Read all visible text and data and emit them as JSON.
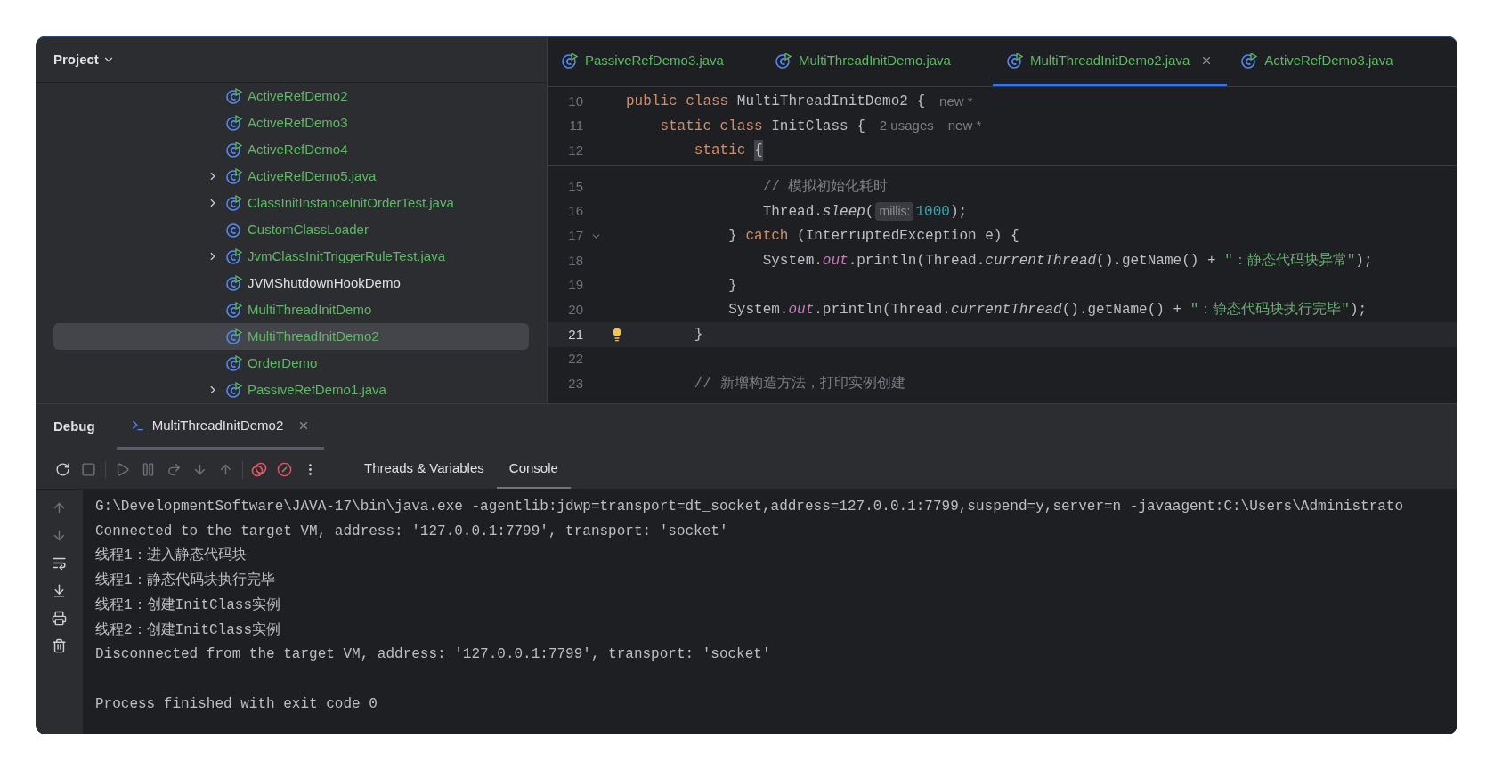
{
  "project": {
    "title": "Project",
    "items": [
      {
        "label": "ActiveRefDemo2",
        "expandable": false,
        "kind": "runnable",
        "color": "#5fb865",
        "selected": false
      },
      {
        "label": "ActiveRefDemo3",
        "expandable": false,
        "kind": "runnable",
        "color": "#5fb865",
        "selected": false
      },
      {
        "label": "ActiveRefDemo4",
        "expandable": false,
        "kind": "runnable",
        "color": "#5fb865",
        "selected": false
      },
      {
        "label": "ActiveRefDemo5.java",
        "expandable": true,
        "kind": "runnable",
        "color": "#5fb865",
        "selected": false
      },
      {
        "label": "ClassInitInstanceInitOrderTest.java",
        "expandable": true,
        "kind": "runnable",
        "color": "#5fb865",
        "selected": false
      },
      {
        "label": "CustomClassLoader",
        "expandable": false,
        "kind": "class",
        "color": "#5fb865",
        "selected": false
      },
      {
        "label": "JvmClassInitTriggerRuleTest.java",
        "expandable": true,
        "kind": "runnable",
        "color": "#5fb865",
        "selected": false
      },
      {
        "label": "JVMShutdownHookDemo",
        "expandable": false,
        "kind": "runnable",
        "color": "#dfe1e5",
        "selected": false
      },
      {
        "label": "MultiThreadInitDemo",
        "expandable": false,
        "kind": "runnable",
        "color": "#5fb865",
        "selected": false
      },
      {
        "label": "MultiThreadInitDemo2",
        "expandable": false,
        "kind": "runnable",
        "color": "#5fb865",
        "selected": true
      },
      {
        "label": "OrderDemo",
        "expandable": false,
        "kind": "runnable",
        "color": "#5fb865",
        "selected": false
      },
      {
        "label": "PassiveRefDemo1.java",
        "expandable": true,
        "kind": "runnable",
        "color": "#5fb865",
        "selected": false
      }
    ]
  },
  "editor": {
    "tabs": [
      {
        "label": "PassiveRefDemo3.java",
        "selected": false
      },
      {
        "label": "MultiThreadInitDemo.java",
        "selected": false
      },
      {
        "label": "MultiThreadInitDemo2.java",
        "selected": true
      },
      {
        "label": "ActiveRefDemo3.java",
        "selected": false
      }
    ],
    "sticky_lines": [
      {
        "number": "10",
        "segments": [
          {
            "kind": "kw",
            "text": "public class "
          },
          {
            "kind": "id",
            "text": "MultiThreadInitDemo2 {"
          },
          {
            "kind": "hint",
            "text": "new *"
          }
        ]
      },
      {
        "number": "11",
        "segments": [
          {
            "kind": "kw",
            "text": "    static class "
          },
          {
            "kind": "id",
            "text": "InitClass {"
          },
          {
            "kind": "hint",
            "text": "2 usages"
          },
          {
            "kind": "hint",
            "text": "new *"
          }
        ]
      },
      {
        "number": "12",
        "segments": [
          {
            "kind": "kw",
            "text": "        static "
          },
          {
            "kind": "brace",
            "text": "{"
          }
        ]
      }
    ],
    "lines": [
      {
        "number": "15",
        "current": false,
        "fold": false,
        "bulb": false,
        "segments": [
          {
            "kind": "cm",
            "text": "                // 模拟初始化耗时"
          }
        ]
      },
      {
        "number": "16",
        "current": false,
        "fold": false,
        "bulb": false,
        "segments": [
          {
            "kind": "id",
            "text": "                Thread."
          },
          {
            "kind": "smethod",
            "text": "sleep"
          },
          {
            "kind": "id",
            "text": "("
          },
          {
            "kind": "param",
            "text": "millis:"
          },
          {
            "kind": "num",
            "text": "1000"
          },
          {
            "kind": "id",
            "text": ");"
          }
        ]
      },
      {
        "number": "17",
        "current": false,
        "fold": true,
        "bulb": false,
        "segments": [
          {
            "kind": "id",
            "text": "            } "
          },
          {
            "kind": "kw",
            "text": "catch "
          },
          {
            "kind": "id",
            "text": "(InterruptedException e) {"
          }
        ]
      },
      {
        "number": "18",
        "current": false,
        "fold": false,
        "bulb": false,
        "segments": [
          {
            "kind": "id",
            "text": "                System."
          },
          {
            "kind": "field",
            "text": "out"
          },
          {
            "kind": "id",
            "text": ".println(Thread."
          },
          {
            "kind": "smethod",
            "text": "currentThread"
          },
          {
            "kind": "id",
            "text": "().getName() + "
          },
          {
            "kind": "str",
            "text": "\"：静态代码块异常\""
          },
          {
            "kind": "id",
            "text": ");"
          }
        ]
      },
      {
        "number": "19",
        "current": false,
        "fold": false,
        "bulb": false,
        "segments": [
          {
            "kind": "id",
            "text": "            }"
          }
        ]
      },
      {
        "number": "20",
        "current": false,
        "fold": false,
        "bulb": false,
        "segments": [
          {
            "kind": "id",
            "text": "            System."
          },
          {
            "kind": "field",
            "text": "out"
          },
          {
            "kind": "id",
            "text": ".println(Thread."
          },
          {
            "kind": "smethod",
            "text": "currentThread"
          },
          {
            "kind": "id",
            "text": "().getName() + "
          },
          {
            "kind": "str",
            "text": "\"：静态代码块执行完毕\""
          },
          {
            "kind": "id",
            "text": ");"
          }
        ]
      },
      {
        "number": "21",
        "current": true,
        "fold": false,
        "bulb": true,
        "segments": [
          {
            "kind": "id",
            "text": "        }"
          }
        ]
      },
      {
        "number": "22",
        "current": false,
        "fold": false,
        "bulb": false
      },
      {
        "number": "23",
        "current": false,
        "fold": false,
        "bulb": false,
        "segments": [
          {
            "kind": "cm",
            "text": "        // 新增构造方法，打印实例创建"
          }
        ]
      }
    ]
  },
  "debug": {
    "title": "Debug",
    "session": "MultiThreadInitDemo2",
    "toolbar": [
      {
        "kind": "rerun",
        "disabled": false
      },
      {
        "kind": "stop",
        "disabled": true
      },
      {
        "kind": "sep"
      },
      {
        "kind": "resume",
        "disabled": true
      },
      {
        "kind": "pause",
        "disabled": true
      },
      {
        "kind": "step_over",
        "disabled": true
      },
      {
        "kind": "step_into",
        "disabled": true
      },
      {
        "kind": "step_out",
        "disabled": true
      },
      {
        "kind": "sep"
      },
      {
        "kind": "breakpoints",
        "disabled": false
      },
      {
        "kind": "mute",
        "disabled": false
      },
      {
        "kind": "more",
        "disabled": false
      }
    ],
    "tabs": [
      {
        "label": "Threads & Variables",
        "selected": false
      },
      {
        "label": "Console",
        "selected": true
      }
    ],
    "console": [
      {
        "kind": "output",
        "text": "G:\\DevelopmentSoftware\\JAVA-17\\bin\\java.exe -agentlib:jdwp=transport=dt_socket,address=127.0.0.1:7799,suspend=y,server=n -javaagent:C:\\Users\\Administrato"
      },
      {
        "kind": "output",
        "text": "Connected to the target VM, address: '127.0.0.1:7799', transport: 'socket'"
      },
      {
        "kind": "output",
        "text": "线程1：进入静态代码块"
      },
      {
        "kind": "output",
        "text": "线程1：静态代码块执行完毕"
      },
      {
        "kind": "output",
        "text": "线程1：创建InitClass实例"
      },
      {
        "kind": "output",
        "text": "线程2：创建InitClass实例"
      },
      {
        "kind": "output",
        "text": "Disconnected from the target VM, address: '127.0.0.1:7799', transport: 'socket'"
      },
      {
        "kind": "exit",
        "text": "Process finished with exit code 0"
      }
    ]
  }
}
